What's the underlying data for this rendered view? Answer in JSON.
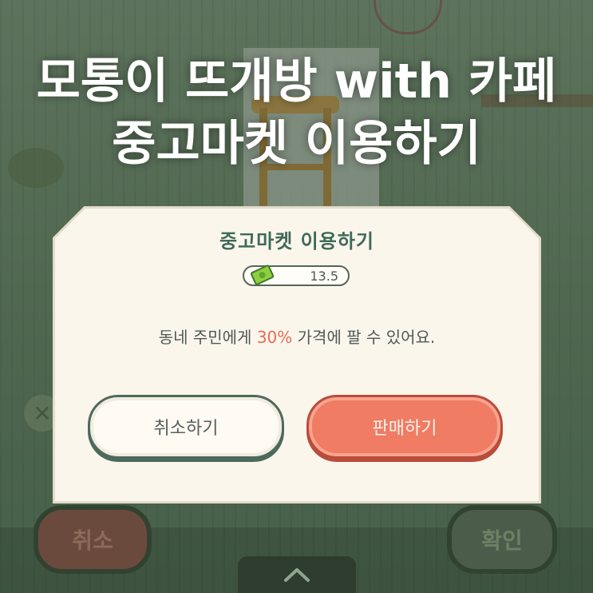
{
  "headline": {
    "line1": "모통이 뜨개방 with 카페",
    "line2": "중고마켓 이용하기"
  },
  "background_buttons": {
    "cancel_label": "취소",
    "confirm_label": "확인"
  },
  "dialog": {
    "title": "중고마켓 이용하기",
    "price_icon": "money-bill-icon",
    "price_value": "13.5",
    "message_prefix": "동네 주민에게 ",
    "message_highlight": "30%",
    "message_suffix": " 가격에 팔 수 있어요.",
    "cancel_label": "취소하기",
    "sell_label": "판매하기"
  },
  "icons": {
    "bottom_tab": "chevron-up-icon",
    "close": "close-icon"
  },
  "colors": {
    "sell_button": "#f07c63",
    "title_text": "#3f6a5a",
    "highlight": "#ec6a53",
    "dialog_bg": "#fbf6ec"
  }
}
